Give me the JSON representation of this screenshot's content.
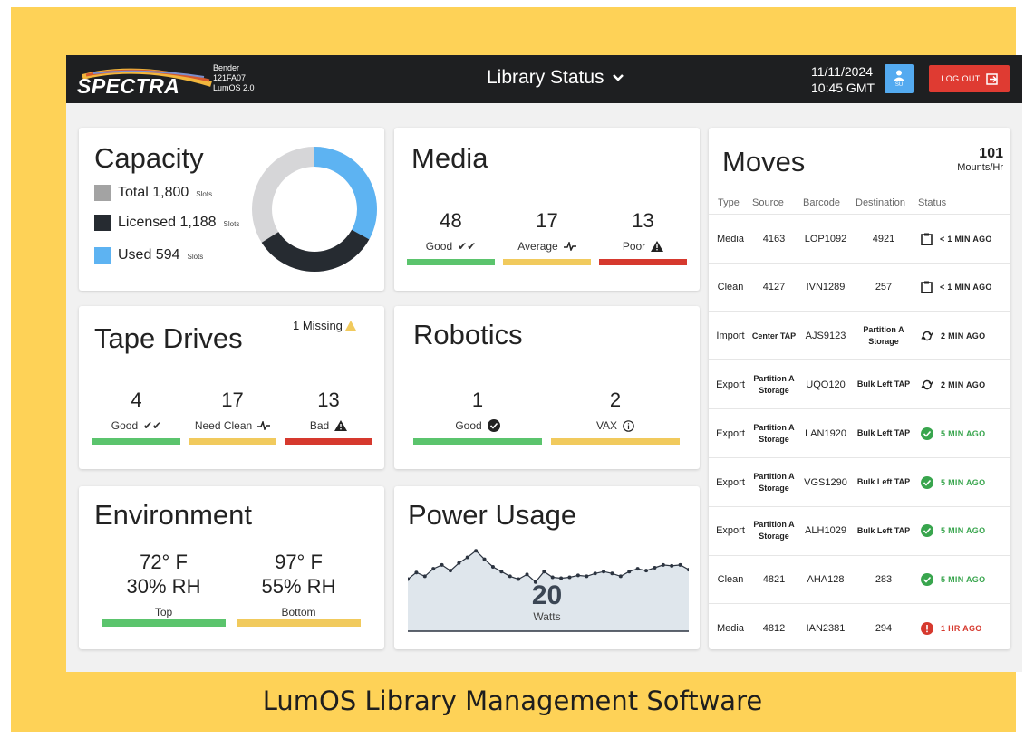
{
  "header": {
    "logo": "SPECTRA",
    "system_name": "Bender",
    "system_id": "121FA07",
    "os_version": "LumOS 2.0",
    "title": "Library Status",
    "date": "11/11/2024",
    "time": "10:45 GMT",
    "user_badge": "SU",
    "logout_label": "LOG OUT"
  },
  "capacity": {
    "title": "Capacity",
    "total_label": "Total 1,800",
    "licensed_label": "Licensed 1,188",
    "used_label": "Used 594",
    "unit": "Slots",
    "total": 1800,
    "licensed": 1188,
    "used": 594,
    "colors": {
      "total": "#a3a3a3",
      "licensed": "#262b31",
      "used": "#5db3f2",
      "ring_bg": "#d6d6d8"
    }
  },
  "media": {
    "title": "Media",
    "stats": [
      {
        "value": "48",
        "label": "Good",
        "color": "#5bc46d"
      },
      {
        "value": "17",
        "label": "Average",
        "color": "#f1ca5d"
      },
      {
        "value": "13",
        "label": "Poor",
        "color": "#d6392e"
      }
    ]
  },
  "tape_drives": {
    "title": "Tape Drives",
    "missing": "1 Missing",
    "stats": [
      {
        "value": "4",
        "label": "Good",
        "color": "#5bc46d"
      },
      {
        "value": "17",
        "label": "Need Clean",
        "color": "#f1ca5d"
      },
      {
        "value": "13",
        "label": "Bad",
        "color": "#d6392e"
      }
    ]
  },
  "robotics": {
    "title": "Robotics",
    "stats": [
      {
        "value": "1",
        "label": "Good",
        "color": "#5bc46d"
      },
      {
        "value": "2",
        "label": "VAX",
        "color": "#f1ca5d"
      }
    ]
  },
  "environment": {
    "title": "Environment",
    "sensors": [
      {
        "temp": "72° F",
        "rh": "30% RH",
        "label": "Top",
        "color": "#5bc46d"
      },
      {
        "temp": "97° F",
        "rh": "55% RH",
        "label": "Bottom",
        "color": "#f1ca5d"
      }
    ]
  },
  "power": {
    "title": "Power Usage",
    "value": "20",
    "unit": "Watts",
    "series": [
      55,
      62,
      58,
      66,
      70,
      64,
      72,
      78,
      85,
      76,
      68,
      63,
      58,
      55,
      60,
      52,
      63,
      57,
      56,
      57,
      59,
      58,
      61,
      63,
      61,
      58,
      63,
      66,
      64,
      67,
      70,
      69,
      70,
      65
    ]
  },
  "moves": {
    "title": "Moves",
    "rate_value": "101",
    "rate_unit": "Mounts/Hr",
    "columns": [
      "Type",
      "Source",
      "Barcode",
      "Destination",
      "Status"
    ],
    "rows": [
      {
        "type": "Media",
        "source": "4163",
        "barcode": "LOP1092",
        "destination": "4921",
        "status": "< 1 MIN AGO",
        "state": "queued"
      },
      {
        "type": "Clean",
        "source": "4127",
        "barcode": "IVN1289",
        "destination": "257",
        "status": "< 1 MIN AGO",
        "state": "queued"
      },
      {
        "type": "Import",
        "source": "Center TAP",
        "barcode": "AJS9123",
        "destination": "Partition A Storage",
        "status": "2 MIN AGO",
        "state": "progress"
      },
      {
        "type": "Export",
        "source": "Partition A Storage",
        "barcode": "UQO120",
        "destination": "Bulk Left TAP",
        "status": "2 MIN AGO",
        "state": "progress"
      },
      {
        "type": "Export",
        "source": "Partition A Storage",
        "barcode": "LAN1920",
        "destination": "Bulk Left TAP",
        "status": "5 MIN AGO",
        "state": "done"
      },
      {
        "type": "Export",
        "source": "Partition A Storage",
        "barcode": "VGS1290",
        "destination": "Bulk Left TAP",
        "status": "5 MIN AGO",
        "state": "done"
      },
      {
        "type": "Export",
        "source": "Partition A Storage",
        "barcode": "ALH1029",
        "destination": "Bulk Left TAP",
        "status": "5 MIN AGO",
        "state": "done"
      },
      {
        "type": "Clean",
        "source": "4821",
        "barcode": "AHA128",
        "destination": "283",
        "status": "5 MIN AGO",
        "state": "done"
      },
      {
        "type": "Media",
        "source": "4812",
        "barcode": "IAN2381",
        "destination": "294",
        "status": "1 HR AGO",
        "state": "error"
      }
    ],
    "state_colors": {
      "queued": "#222222",
      "progress": "#222222",
      "done": "#38a54d",
      "error": "#d6392e"
    }
  },
  "caption": "LumOS Library Management Software"
}
